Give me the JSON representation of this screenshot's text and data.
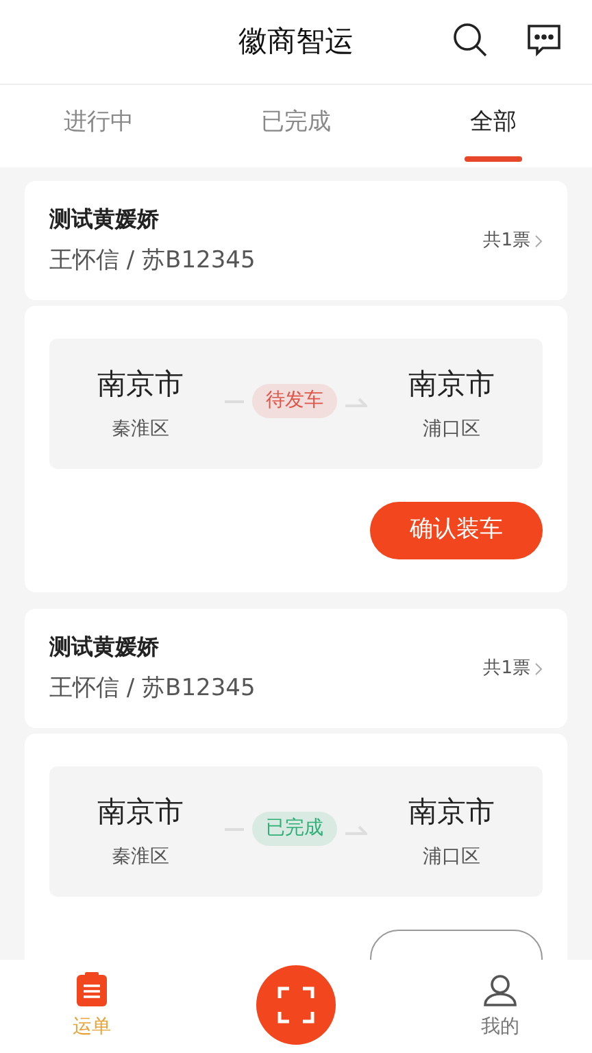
{
  "header": {
    "title": "徽商智运"
  },
  "tabs": [
    {
      "label": "进行中",
      "selected": false
    },
    {
      "label": "已完成",
      "selected": false
    },
    {
      "label": "全部",
      "selected": true
    }
  ],
  "orders": [
    {
      "name": "测试黄媛娇",
      "driver": "王怀信 / 苏B12345",
      "count": "共1票",
      "from_city": "南京市",
      "from_district": "秦淮区",
      "status": {
        "label": "待发车",
        "color": "#e0554a"
      },
      "to_city": "南京市",
      "to_district": "浦口区",
      "action": {
        "label": "确认装车",
        "kind": "primary"
      }
    },
    {
      "name": "测试黄媛娇",
      "driver": "王怀信 / 苏B12345",
      "count": "共1票",
      "from_city": "南京市",
      "from_district": "秦淮区",
      "status": {
        "label": "已完成",
        "color": "#2fae78"
      },
      "to_city": "南京市",
      "to_district": "浦口区",
      "action": {
        "kind": "outline"
      }
    }
  ],
  "nav": [
    {
      "label": "运单",
      "kind": "orders",
      "selected": true
    },
    {
      "kind": "scan"
    },
    {
      "label": "我的",
      "kind": "profile",
      "selected": false
    }
  ]
}
